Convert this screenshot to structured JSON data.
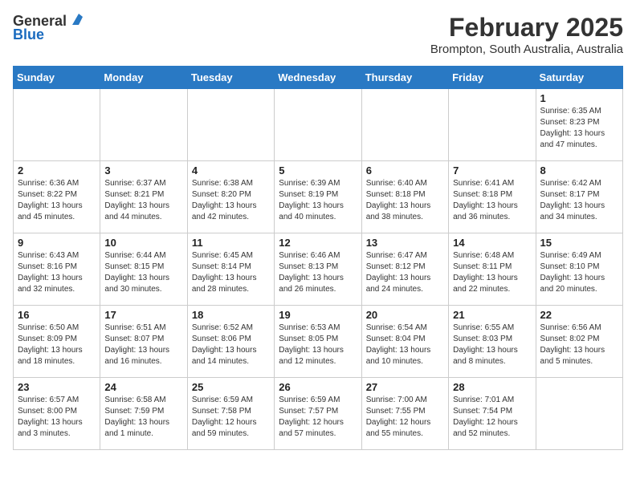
{
  "header": {
    "logo_general": "General",
    "logo_blue": "Blue",
    "month": "February 2025",
    "location": "Brompton, South Australia, Australia"
  },
  "days_of_week": [
    "Sunday",
    "Monday",
    "Tuesday",
    "Wednesday",
    "Thursday",
    "Friday",
    "Saturday"
  ],
  "weeks": [
    [
      {
        "day": "",
        "info": ""
      },
      {
        "day": "",
        "info": ""
      },
      {
        "day": "",
        "info": ""
      },
      {
        "day": "",
        "info": ""
      },
      {
        "day": "",
        "info": ""
      },
      {
        "day": "",
        "info": ""
      },
      {
        "day": "1",
        "info": "Sunrise: 6:35 AM\nSunset: 8:23 PM\nDaylight: 13 hours\nand 47 minutes."
      }
    ],
    [
      {
        "day": "2",
        "info": "Sunrise: 6:36 AM\nSunset: 8:22 PM\nDaylight: 13 hours\nand 45 minutes."
      },
      {
        "day": "3",
        "info": "Sunrise: 6:37 AM\nSunset: 8:21 PM\nDaylight: 13 hours\nand 44 minutes."
      },
      {
        "day": "4",
        "info": "Sunrise: 6:38 AM\nSunset: 8:20 PM\nDaylight: 13 hours\nand 42 minutes."
      },
      {
        "day": "5",
        "info": "Sunrise: 6:39 AM\nSunset: 8:19 PM\nDaylight: 13 hours\nand 40 minutes."
      },
      {
        "day": "6",
        "info": "Sunrise: 6:40 AM\nSunset: 8:18 PM\nDaylight: 13 hours\nand 38 minutes."
      },
      {
        "day": "7",
        "info": "Sunrise: 6:41 AM\nSunset: 8:18 PM\nDaylight: 13 hours\nand 36 minutes."
      },
      {
        "day": "8",
        "info": "Sunrise: 6:42 AM\nSunset: 8:17 PM\nDaylight: 13 hours\nand 34 minutes."
      }
    ],
    [
      {
        "day": "9",
        "info": "Sunrise: 6:43 AM\nSunset: 8:16 PM\nDaylight: 13 hours\nand 32 minutes."
      },
      {
        "day": "10",
        "info": "Sunrise: 6:44 AM\nSunset: 8:15 PM\nDaylight: 13 hours\nand 30 minutes."
      },
      {
        "day": "11",
        "info": "Sunrise: 6:45 AM\nSunset: 8:14 PM\nDaylight: 13 hours\nand 28 minutes."
      },
      {
        "day": "12",
        "info": "Sunrise: 6:46 AM\nSunset: 8:13 PM\nDaylight: 13 hours\nand 26 minutes."
      },
      {
        "day": "13",
        "info": "Sunrise: 6:47 AM\nSunset: 8:12 PM\nDaylight: 13 hours\nand 24 minutes."
      },
      {
        "day": "14",
        "info": "Sunrise: 6:48 AM\nSunset: 8:11 PM\nDaylight: 13 hours\nand 22 minutes."
      },
      {
        "day": "15",
        "info": "Sunrise: 6:49 AM\nSunset: 8:10 PM\nDaylight: 13 hours\nand 20 minutes."
      }
    ],
    [
      {
        "day": "16",
        "info": "Sunrise: 6:50 AM\nSunset: 8:09 PM\nDaylight: 13 hours\nand 18 minutes."
      },
      {
        "day": "17",
        "info": "Sunrise: 6:51 AM\nSunset: 8:07 PM\nDaylight: 13 hours\nand 16 minutes."
      },
      {
        "day": "18",
        "info": "Sunrise: 6:52 AM\nSunset: 8:06 PM\nDaylight: 13 hours\nand 14 minutes."
      },
      {
        "day": "19",
        "info": "Sunrise: 6:53 AM\nSunset: 8:05 PM\nDaylight: 13 hours\nand 12 minutes."
      },
      {
        "day": "20",
        "info": "Sunrise: 6:54 AM\nSunset: 8:04 PM\nDaylight: 13 hours\nand 10 minutes."
      },
      {
        "day": "21",
        "info": "Sunrise: 6:55 AM\nSunset: 8:03 PM\nDaylight: 13 hours\nand 8 minutes."
      },
      {
        "day": "22",
        "info": "Sunrise: 6:56 AM\nSunset: 8:02 PM\nDaylight: 13 hours\nand 5 minutes."
      }
    ],
    [
      {
        "day": "23",
        "info": "Sunrise: 6:57 AM\nSunset: 8:00 PM\nDaylight: 13 hours\nand 3 minutes."
      },
      {
        "day": "24",
        "info": "Sunrise: 6:58 AM\nSunset: 7:59 PM\nDaylight: 13 hours\nand 1 minute."
      },
      {
        "day": "25",
        "info": "Sunrise: 6:59 AM\nSunset: 7:58 PM\nDaylight: 12 hours\nand 59 minutes."
      },
      {
        "day": "26",
        "info": "Sunrise: 6:59 AM\nSunset: 7:57 PM\nDaylight: 12 hours\nand 57 minutes."
      },
      {
        "day": "27",
        "info": "Sunrise: 7:00 AM\nSunset: 7:55 PM\nDaylight: 12 hours\nand 55 minutes."
      },
      {
        "day": "28",
        "info": "Sunrise: 7:01 AM\nSunset: 7:54 PM\nDaylight: 12 hours\nand 52 minutes."
      },
      {
        "day": "",
        "info": ""
      }
    ]
  ]
}
